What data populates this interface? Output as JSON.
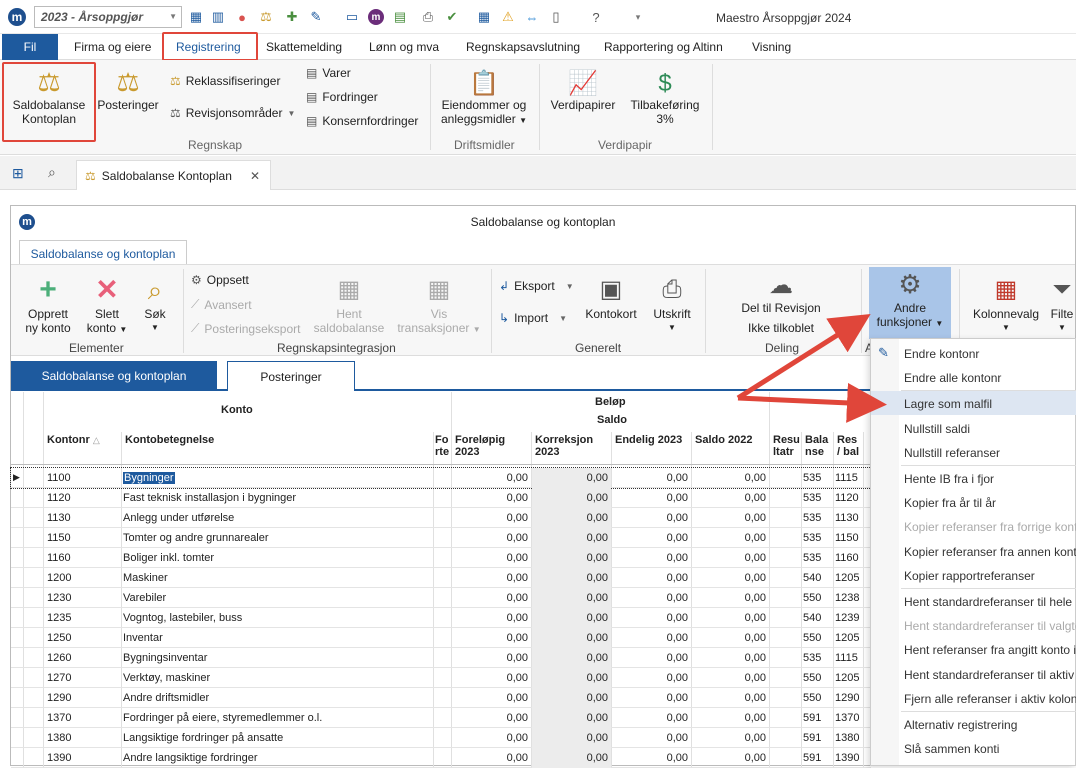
{
  "app": {
    "title": "Maestro Årsoppgjør 2024",
    "year_selector": "2023 - Årsoppgjør"
  },
  "menu": {
    "items": [
      "Fil",
      "Firma og eiere",
      "Registrering",
      "Skattemelding",
      "Lønn og mva",
      "Regnskapsavslutning",
      "Rapportering og Altinn",
      "Visning"
    ]
  },
  "ribbon": {
    "saldobalanse_l1": "Saldobalanse",
    "saldobalanse_l2": "Kontoplan",
    "posteringer": "Posteringer",
    "reklassifiseringer": "Reklassifiseringer",
    "revisjonsomrader": "Revisjonsområder",
    "varer": "Varer",
    "fordringer": "Fordringer",
    "konsernfordringer": "Konsernfordringer",
    "regnskap_group": "Regnskap",
    "eiendommer_l1": "Eiendommer og",
    "eiendommer_l2": "anleggsmidler",
    "driftsmidler_group": "Driftsmidler",
    "verdipapirer": "Verdipapirer",
    "tilbakeforing_l1": "Tilbakeføring",
    "tilbakeforing_l2": "3%",
    "verdipapir_group": "Verdipapir"
  },
  "doctab": {
    "label": "Saldobalanse Kontoplan"
  },
  "inner": {
    "title": "Saldobalanse og kontoplan",
    "tab": "Saldobalanse og kontoplan",
    "ribbon": {
      "opprett_l1": "Opprett",
      "opprett_l2": "ny konto",
      "slett_l1": "Slett",
      "slett_l2": "konto",
      "sok": "Søk",
      "elementer_group": "Elementer",
      "oppsett": "Oppsett",
      "avansert": "Avansert",
      "posteringseksport": "Posteringseksport",
      "hent_l1": "Hent",
      "hent_l2": "saldobalanse",
      "vis_l1": "Vis",
      "vis_l2": "transaksjoner",
      "regnskapsintegrasjon_group": "Regnskapsintegrasjon",
      "eksport": "Eksport",
      "import": "Import",
      "kontokort": "Kontokort",
      "utskrift": "Utskrift",
      "generelt_group": "Generelt",
      "del_til_revisjon": "Del til Revisjon",
      "ikke_tilkoblet": "Ikke tilkoblet",
      "deling_group": "Deling",
      "andre_l1": "Andre",
      "andre_l2": "funksjoner",
      "a_group": "A",
      "kolonnevalg": "Kolonnevalg",
      "filter": "Filte"
    },
    "subtabs": [
      "Saldobalanse og kontoplan",
      "Posteringer"
    ]
  },
  "grid": {
    "header_konto": "Konto",
    "header_belop": "Beløp",
    "header_saldo": "Saldo",
    "columns": {
      "kontonr": "Kontonr",
      "kontobetegnelse": "Kontobetegnelse",
      "fo_l1": "Fo",
      "fo_l2": "rte",
      "forelopig_l1": "Foreløpig",
      "forelopig_l2": "2023",
      "korreksjon_l1": "Korreksjon",
      "korreksjon_l2": "2023",
      "endelig": "Endelig 2023",
      "saldo2022": "Saldo 2022",
      "resu_l1": "Resu",
      "resu_l2": "ltatr",
      "bala_l1": "Bala",
      "bala_l2": "nse",
      "res_l1": "Res",
      "res_l2": "/ bal"
    },
    "rows": [
      {
        "nr": "1100",
        "name": "Bygninger",
        "f": "0,00",
        "k": "0,00",
        "e": "0,00",
        "s": "0,00",
        "b": "535",
        "r": "1115"
      },
      {
        "nr": "1120",
        "name": "Fast teknisk installasjon i bygninger",
        "f": "0,00",
        "k": "0,00",
        "e": "0,00",
        "s": "0,00",
        "b": "535",
        "r": "1120"
      },
      {
        "nr": "1130",
        "name": "Anlegg under utførelse",
        "f": "0,00",
        "k": "0,00",
        "e": "0,00",
        "s": "0,00",
        "b": "535",
        "r": "1130"
      },
      {
        "nr": "1150",
        "name": "Tomter og andre grunnarealer",
        "f": "0,00",
        "k": "0,00",
        "e": "0,00",
        "s": "0,00",
        "b": "535",
        "r": "1150"
      },
      {
        "nr": "1160",
        "name": "Boliger inkl. tomter",
        "f": "0,00",
        "k": "0,00",
        "e": "0,00",
        "s": "0,00",
        "b": "535",
        "r": "1160"
      },
      {
        "nr": "1200",
        "name": "Maskiner",
        "f": "0,00",
        "k": "0,00",
        "e": "0,00",
        "s": "0,00",
        "b": "540",
        "r": "1205"
      },
      {
        "nr": "1230",
        "name": "Varebiler",
        "f": "0,00",
        "k": "0,00",
        "e": "0,00",
        "s": "0,00",
        "b": "550",
        "r": "1238"
      },
      {
        "nr": "1235",
        "name": "Vogntog, lastebiler, buss",
        "f": "0,00",
        "k": "0,00",
        "e": "0,00",
        "s": "0,00",
        "b": "540",
        "r": "1239"
      },
      {
        "nr": "1250",
        "name": "Inventar",
        "f": "0,00",
        "k": "0,00",
        "e": "0,00",
        "s": "0,00",
        "b": "550",
        "r": "1205"
      },
      {
        "nr": "1260",
        "name": "Bygningsinventar",
        "f": "0,00",
        "k": "0,00",
        "e": "0,00",
        "s": "0,00",
        "b": "535",
        "r": "1115"
      },
      {
        "nr": "1270",
        "name": "Verktøy, maskiner",
        "f": "0,00",
        "k": "0,00",
        "e": "0,00",
        "s": "0,00",
        "b": "550",
        "r": "1205"
      },
      {
        "nr": "1290",
        "name": "Andre driftsmidler",
        "f": "0,00",
        "k": "0,00",
        "e": "0,00",
        "s": "0,00",
        "b": "550",
        "r": "1290"
      },
      {
        "nr": "1370",
        "name": "Fordringer på eiere, styremedlemmer o.l.",
        "f": "0,00",
        "k": "0,00",
        "e": "0,00",
        "s": "0,00",
        "b": "591",
        "r": "1370"
      },
      {
        "nr": "1380",
        "name": "Langsiktige fordringer på ansatte",
        "f": "0,00",
        "k": "0,00",
        "e": "0,00",
        "s": "0,00",
        "b": "591",
        "r": "1380"
      },
      {
        "nr": "1390",
        "name": "Andre langsiktige fordringer",
        "f": "0,00",
        "k": "0,00",
        "e": "0,00",
        "s": "0,00",
        "b": "591",
        "r": "1390"
      }
    ]
  },
  "dropdown": {
    "items": [
      {
        "label": "Endre kontonr",
        "disabled": false
      },
      {
        "label": "Endre alle kontonr",
        "disabled": false
      },
      {
        "label": "Lagre som malfil",
        "disabled": false
      },
      {
        "label": "Nullstill saldi",
        "disabled": false
      },
      {
        "label": "Nullstill referanser",
        "disabled": false
      },
      {
        "label": "Hente IB fra i fjor",
        "disabled": false
      },
      {
        "label": "Kopier fra år til år",
        "disabled": false
      },
      {
        "label": "Kopier referanser fra forrige konto",
        "disabled": true
      },
      {
        "label": "Kopier referanser fra annen konto",
        "disabled": false
      },
      {
        "label": "Kopier rapportreferanser",
        "disabled": false
      },
      {
        "label": "Hent standardreferanser til hele k",
        "disabled": false
      },
      {
        "label": "Hent standardreferanser til valgte",
        "disabled": true
      },
      {
        "label": "Hent referanser fra angitt konto i",
        "disabled": false
      },
      {
        "label": "Hent standardreferanser til aktiv",
        "disabled": false
      },
      {
        "label": "Fjern alle referanser i aktiv kolonn",
        "disabled": false
      },
      {
        "label": "Alternativ registrering",
        "disabled": false
      },
      {
        "label": "Slå sammen konti",
        "disabled": false
      }
    ]
  },
  "colors": {
    "accent": "#1e5a9e",
    "highlight_box": "#e0463a",
    "arrow": "#e0463a"
  }
}
